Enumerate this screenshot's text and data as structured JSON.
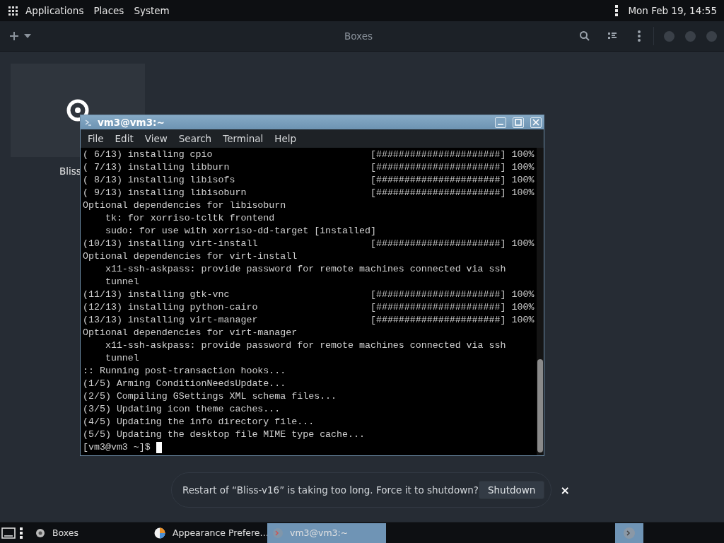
{
  "top_panel": {
    "menus": [
      "Applications",
      "Places",
      "System"
    ],
    "clock": "Mon Feb 19, 14:55"
  },
  "header_bar": {
    "title": "Boxes"
  },
  "boxes": [
    {
      "label": "Bliss"
    }
  ],
  "terminal": {
    "title": "vm3@vm3:~",
    "menus": [
      "File",
      "Edit",
      "View",
      "Search",
      "Terminal",
      "Help"
    ],
    "lines": [
      "( 6/13) installing cpio                            [######################] 100%",
      "( 7/13) installing libburn                         [######################] 100%",
      "( 8/13) installing libisofs                        [######################] 100%",
      "( 9/13) installing libisoburn                      [######################] 100%",
      "Optional dependencies for libisoburn",
      "    tk: for xorriso-tcltk frontend",
      "    sudo: for use with xorriso-dd-target [installed]",
      "(10/13) installing virt-install                    [######################] 100%",
      "Optional dependencies for virt-install",
      "    x11-ssh-askpass: provide password for remote machines connected via ssh",
      "    tunnel",
      "(11/13) installing gtk-vnc                         [######################] 100%",
      "(12/13) installing python-cairo                    [######################] 100%",
      "(13/13) installing virt-manager                    [######################] 100%",
      "Optional dependencies for virt-manager",
      "    x11-ssh-askpass: provide password for remote machines connected via ssh",
      "    tunnel",
      ":: Running post-transaction hooks...",
      "(1/5) Arming ConditionNeedsUpdate...",
      "(2/5) Compiling GSettings XML schema files...",
      "(3/5) Updating icon theme caches...",
      "(4/5) Updating the info directory file...",
      "(5/5) Updating the desktop file MIME type cache..."
    ],
    "prompt": "[vm3@vm3 ~]$"
  },
  "notification": {
    "message": "Restart of “Bliss-v16” is taking too long. Force it to shutdown?",
    "button": "Shutdown",
    "close": "×"
  },
  "taskbar": {
    "tasks": [
      {
        "label": "Boxes",
        "kind": "boxes",
        "selected": false
      },
      {
        "label": "Appearance Prefere…",
        "kind": "appearance",
        "selected": false
      },
      {
        "label": "vm3@vm3:~",
        "kind": "terminal",
        "selected": true
      }
    ]
  }
}
